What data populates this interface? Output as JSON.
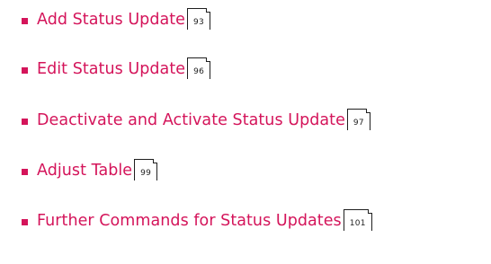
{
  "toc": {
    "entries": [
      {
        "label": "Add Status Update",
        "page": "93"
      },
      {
        "label": "Edit Status Update",
        "page": "96"
      },
      {
        "label": "Deactivate and Activate Status Update",
        "page": "97"
      },
      {
        "label": "Adjust Table",
        "page": "99"
      },
      {
        "label": "Further Commands for Status Updates",
        "page": "101"
      }
    ]
  },
  "colors": {
    "link": "#d4145a",
    "page_box": "#1f1f1f"
  }
}
